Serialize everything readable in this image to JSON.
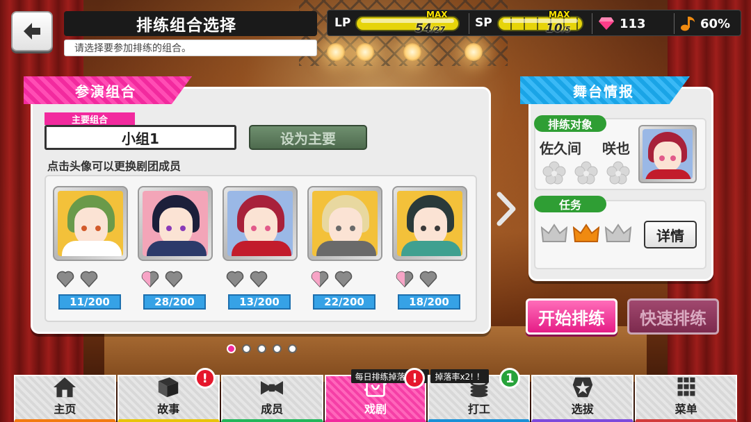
{
  "header": {
    "title": "排练组合选择",
    "subtitle": "请选择要参加排练的组合。"
  },
  "status": {
    "lp_label": "LP",
    "lp_max_label": "MAX",
    "lp_current": "54",
    "lp_max": "/27",
    "sp_label": "SP",
    "sp_max_label": "MAX",
    "sp_current": "10",
    "sp_max": "/5",
    "gems": "113",
    "progress": "60%"
  },
  "left_panel": {
    "tag": "参演组合",
    "main_tag": "主要组合",
    "team_name": "小组1",
    "set_main_button": "设为主要",
    "hint": "点击头像可以更换剧团成员",
    "members": [
      {
        "exp": "11/200",
        "hair": "#6a9a4a",
        "bg": "#f3c13a",
        "eye": "#d25a2a",
        "body": "#ffffff",
        "hearts_filled": 0
      },
      {
        "exp": "28/200",
        "hair": "#1c1f3a",
        "bg": "#f3a5b8",
        "eye": "#8a3ab8",
        "body": "#2c3a6a",
        "hearts_filled": 1
      },
      {
        "exp": "13/200",
        "hair": "#a8213a",
        "bg": "#9ab8e6",
        "eye": "#e25a8a",
        "body": "#c21c2c",
        "hearts_filled": 0
      },
      {
        "exp": "22/200",
        "hair": "#e8d8a0",
        "bg": "#f3c13a",
        "eye": "#6a6a6a",
        "body": "#6a6a6a",
        "hearts_filled": 1
      },
      {
        "exp": "18/200",
        "hair": "#2a3a3a",
        "bg": "#f3c13a",
        "eye": "#3a3a3a",
        "body": "#3fa090",
        "hearts_filled": 1
      }
    ],
    "page_dots": 5,
    "active_dot": 0
  },
  "right_panel": {
    "tag": "舞台情报",
    "target_label": "排练对象",
    "char_first": "佐久间",
    "char_second": "咲也",
    "mission_label": "任务",
    "detail_button": "详情",
    "crowns_gold": 1
  },
  "actions": {
    "start": "开始排练",
    "quick": "快速排练"
  },
  "nav": {
    "items": [
      {
        "label": "主页",
        "icon": "house-icon"
      },
      {
        "label": "故事",
        "icon": "book-icon",
        "badge": "!"
      },
      {
        "label": "成员",
        "icon": "bowtie-icon"
      },
      {
        "label": "戏剧",
        "icon": "theater-icon",
        "badge": "!",
        "promo": "每日排练掉落率UP"
      },
      {
        "label": "打工",
        "icon": "coins-icon",
        "badge": "1",
        "promo": "掉落率x2! ！"
      },
      {
        "label": "选拔",
        "icon": "star-badge-icon"
      },
      {
        "label": "菜单",
        "icon": "grid-menu-icon"
      }
    ]
  },
  "colors": {
    "pink": "#f22a9e",
    "blue": "#1aa4e6",
    "green": "#2f9e34",
    "gold_crown": "#f08a10"
  }
}
